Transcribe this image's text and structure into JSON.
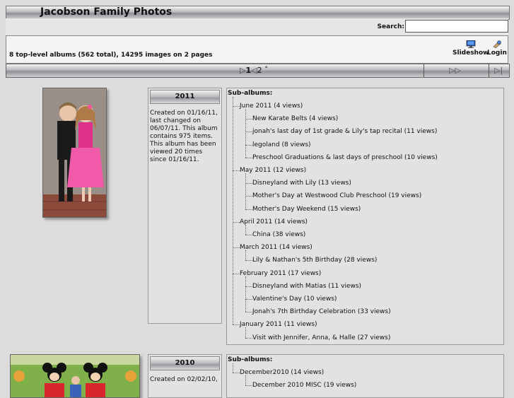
{
  "header": {
    "title": "Jacobson Family Photos"
  },
  "search": {
    "label": "Search:",
    "placeholder": ""
  },
  "summary": {
    "text": "8 top-level albums (562 total), 14295 images on 2 pages"
  },
  "toolbar": {
    "slideshow_label": "Slideshow",
    "login_label": "Login"
  },
  "pager": {
    "text": "1  2",
    "current": "1",
    "other": "2",
    "mark": "°"
  },
  "albums": [
    {
      "year": "2011",
      "description": "Created on 01/16/11, last changed on 06/07/11. This album contains 975 items. This album has been viewed 20 times since 01/16/11.",
      "subalbums_label": "Sub-albums:",
      "months": [
        {
          "label": "June 2011 (4 views)",
          "children": [
            "New Karate Belts (4 views)",
            "jonah's last day of 1st grade & Lily's tap recital (11 views)",
            "legoland (8 views)",
            "Preschool Graduations & last days of preschool (10 views)"
          ]
        },
        {
          "label": "May 2011 (12 views)",
          "children": [
            "Disneyland with Lily (13 views)",
            "Mother's Day at Westwood Club Preschool (19 views)",
            "Mother's Day Weekend (15 views)"
          ]
        },
        {
          "label": "April 2011 (14 views)",
          "children": [
            "China (38 views)"
          ]
        },
        {
          "label": "March 2011 (14 views)",
          "children": [
            "Lily & Nathan's 5th Birthday (28 views)"
          ]
        },
        {
          "label": "February 2011 (17 views)",
          "children": [
            "Disneyland with Matias (11 views)",
            "Valentine's Day (10 views)",
            "Jonah's 7th Birthday Celebration (33 views)"
          ]
        },
        {
          "label": "January 2011 (11 views)",
          "children": [
            "Visit with Jennifer, Anna, & Halle (27 views)"
          ]
        }
      ]
    },
    {
      "year": "2010",
      "description": "Created on 02/02/10,",
      "subalbums_label": "Sub-albums:",
      "months": [
        {
          "label": "December2010 (14 views)",
          "children": [
            "December 2010 MISC (19 views)"
          ]
        }
      ]
    }
  ]
}
